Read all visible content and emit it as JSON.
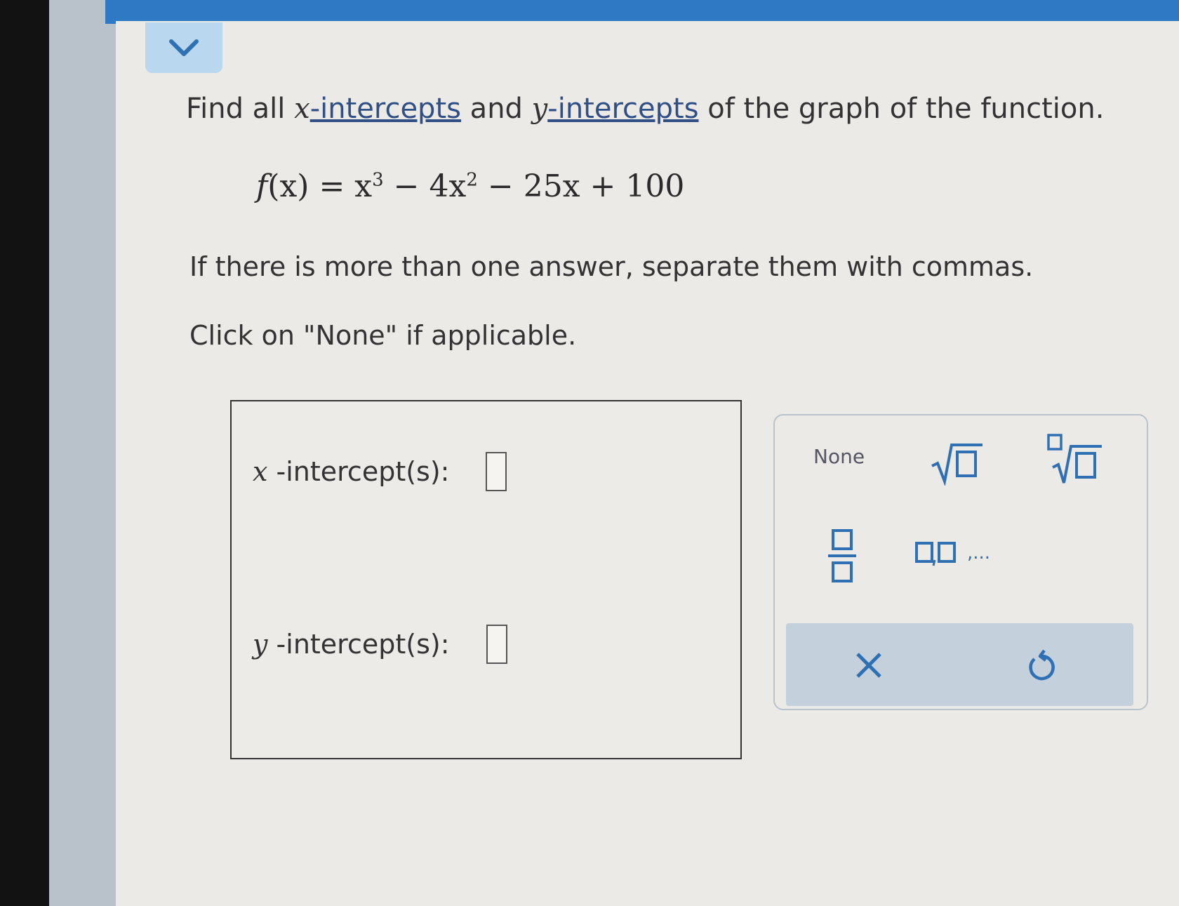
{
  "question": {
    "part1": "Find all ",
    "x_var": "x",
    "link1": "-intercepts",
    "part2": " and ",
    "y_var": "y",
    "link2": "-intercepts",
    "part3": " of the graph of the function."
  },
  "formula": {
    "fname": "f",
    "arg": "(x)",
    "eq": " = x",
    "exp1": "3",
    "mid": " − 4x",
    "exp2": "2",
    "tail": " − 25x + 100"
  },
  "instructions": {
    "line1": "If there is more than one answer, separate them with commas.",
    "line2": "Click on \"None\" if applicable."
  },
  "answers": {
    "x_var": "x",
    "x_label": " -intercept(s):",
    "y_var": "y",
    "y_label": " -intercept(s):"
  },
  "keypad": {
    "none_label": "None",
    "list_ellipsis": ",..."
  },
  "colors": {
    "top_bar": "#2f78c4",
    "accent_icon": "#2f6fb3",
    "keypad_action_bar": "#c4d1dd"
  },
  "icons": [
    "chevron-down-icon",
    "sqrt-icon",
    "nth-root-icon",
    "fraction-icon",
    "list-icon",
    "clear-x-icon",
    "undo-icon"
  ]
}
